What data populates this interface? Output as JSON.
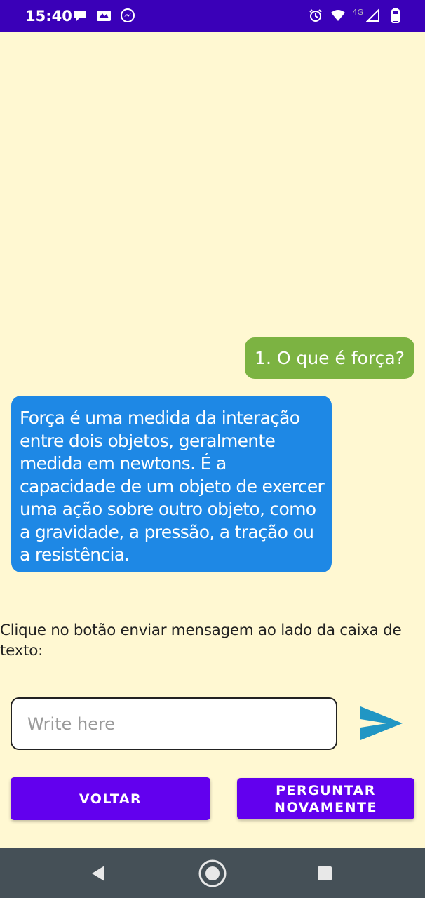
{
  "status_bar": {
    "time": "15:40",
    "left_icons": [
      "chat-bubble-icon",
      "notification-icon",
      "messenger-icon"
    ],
    "network_label": "4G",
    "right_icons": [
      "alarm-icon",
      "wifi-icon",
      "signal-icon",
      "battery-icon"
    ]
  },
  "chat": {
    "user_message": "1. O que é força?",
    "bot_message": "Força é uma medida da interação entre dois objetos, geralmente medida em newtons. É a capacidade de um objeto de exercer uma ação sobre outro objeto, como a gravidade, a pressão, a tração ou a resistência."
  },
  "instruction": "Clique no botão enviar mensagem ao lado da caixa de texto:",
  "input": {
    "placeholder": "Write here",
    "value": ""
  },
  "buttons": {
    "back_label": "VOLTAR",
    "ask_again_label": "PERGUNTAR NOVAMENTE"
  },
  "nav_bar": {
    "icons": [
      "back-icon",
      "home-icon",
      "recents-icon"
    ]
  },
  "colors": {
    "background": "#FFF8D2",
    "status_bar": "#3A00B8",
    "user_bubble": "#7CB342",
    "bot_bubble": "#1E88E5",
    "button": "#6200EE",
    "send_icon": "#2196C4",
    "nav_bar": "#455057"
  }
}
